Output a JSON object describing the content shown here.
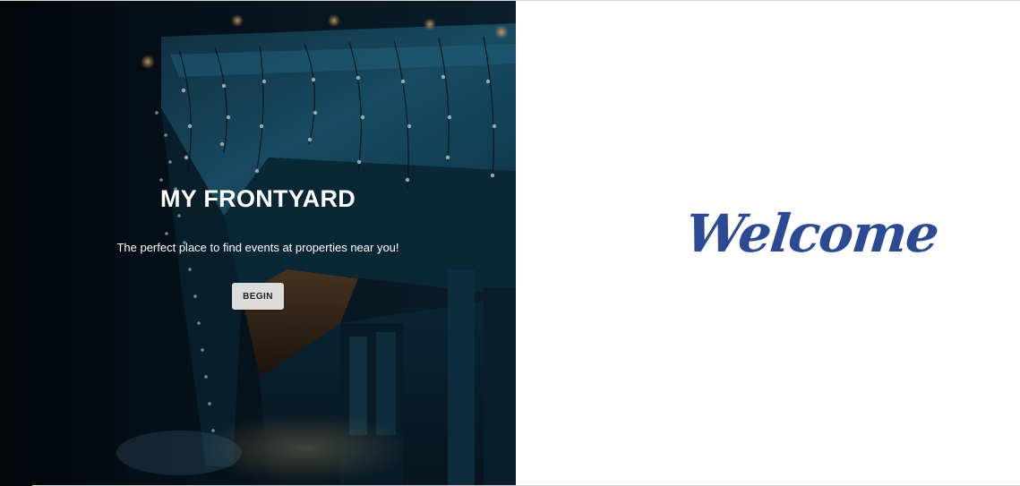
{
  "hero": {
    "title": "MY FRONTYARD",
    "subtitle": "The perfect place to find events at properties near you!",
    "begin_label": "BEGIN",
    "background_image": "night-storefront-string-lights"
  },
  "welcome": {
    "text": "Welcome"
  },
  "colors": {
    "welcome_text": "#2c4a93",
    "hero_text": "#ffffff",
    "button_bg": "#ececec",
    "hero_dark": "#050b12",
    "hero_teal": "#1e5d78"
  }
}
